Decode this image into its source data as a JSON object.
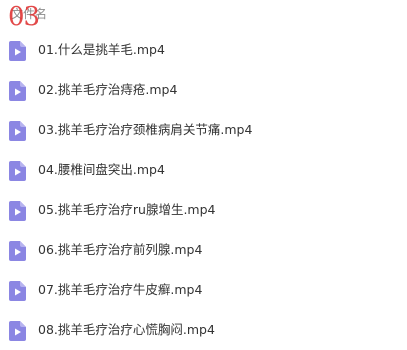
{
  "header": {
    "column_label": "文件名",
    "overlay_number": "03"
  },
  "colors": {
    "icon_fill": "#8b86e3",
    "icon_fold": "#b7b3f0",
    "overlay_number": "#e03a3a"
  },
  "files": [
    {
      "name": "01.什么是挑羊毛.mp4",
      "icon": "video-file-icon"
    },
    {
      "name": "02.挑羊毛疗治痔疮.mp4",
      "icon": "video-file-icon"
    },
    {
      "name": "03.挑羊毛疗治疗颈椎病肩关节痛.mp4",
      "icon": "video-file-icon"
    },
    {
      "name": "04.腰椎间盘突出.mp4",
      "icon": "video-file-icon"
    },
    {
      "name": "05.挑羊毛疗治疗ru腺增生.mp4",
      "icon": "video-file-icon"
    },
    {
      "name": "06.挑羊毛疗治疗前列腺.mp4",
      "icon": "video-file-icon"
    },
    {
      "name": "07.挑羊毛疗治疗牛皮癣.mp4",
      "icon": "video-file-icon"
    },
    {
      "name": "08.挑羊毛疗治疗心慌胸闷.mp4",
      "icon": "video-file-icon"
    }
  ]
}
